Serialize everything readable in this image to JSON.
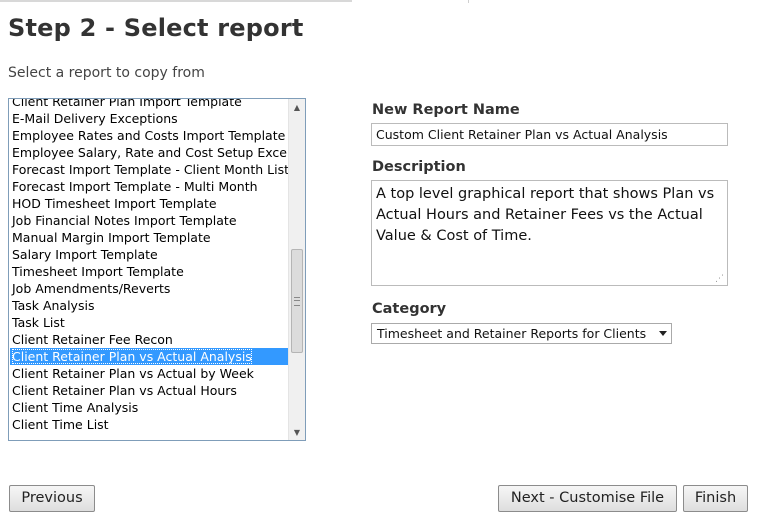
{
  "page": {
    "title": "Step 2 - Select report",
    "subtitle": "Select a report to copy from"
  },
  "report_list": {
    "items": [
      "Client Retainer Plan Import Template",
      "E-Mail Delivery Exceptions",
      "Employee Rates and Costs Import Template",
      "Employee Salary, Rate and Cost Setup Exceptions",
      "Forecast Import Template - Client Month List",
      "Forecast Import Template - Multi Month",
      "HOD Timesheet Import Template",
      "Job Financial Notes Import Template",
      "Manual Margin Import Template",
      "Salary Import Template",
      "Timesheet Import Template",
      "Job Amendments/Reverts",
      "Task Analysis",
      "Task List",
      "Client Retainer Fee Recon",
      "Client Retainer Plan vs Actual Analysis",
      "Client Retainer Plan vs Actual by Week",
      "Client Retainer Plan vs Actual Hours",
      "Client Time Analysis",
      "Client Time List"
    ],
    "selected": "Client Retainer Plan vs Actual Analysis"
  },
  "form": {
    "name_label": "New Report Name",
    "name_value": "Custom Client Retainer Plan vs Actual Analysis",
    "description_label": "Description",
    "description_value": "A top level graphical report that shows Plan vs Actual Hours and Retainer Fees vs the Actual Value & Cost of Time.",
    "category_label": "Category",
    "category_value": "Timesheet and Retainer Reports for Clients"
  },
  "buttons": {
    "previous": "Previous",
    "next": "Next - Customise File",
    "finish": "Finish"
  },
  "colors": {
    "selection": "#3399ff",
    "list_border": "#7f9db9"
  },
  "icons": {
    "scroll_up": "▲",
    "scroll_down": "▼",
    "resize": "⋰"
  }
}
